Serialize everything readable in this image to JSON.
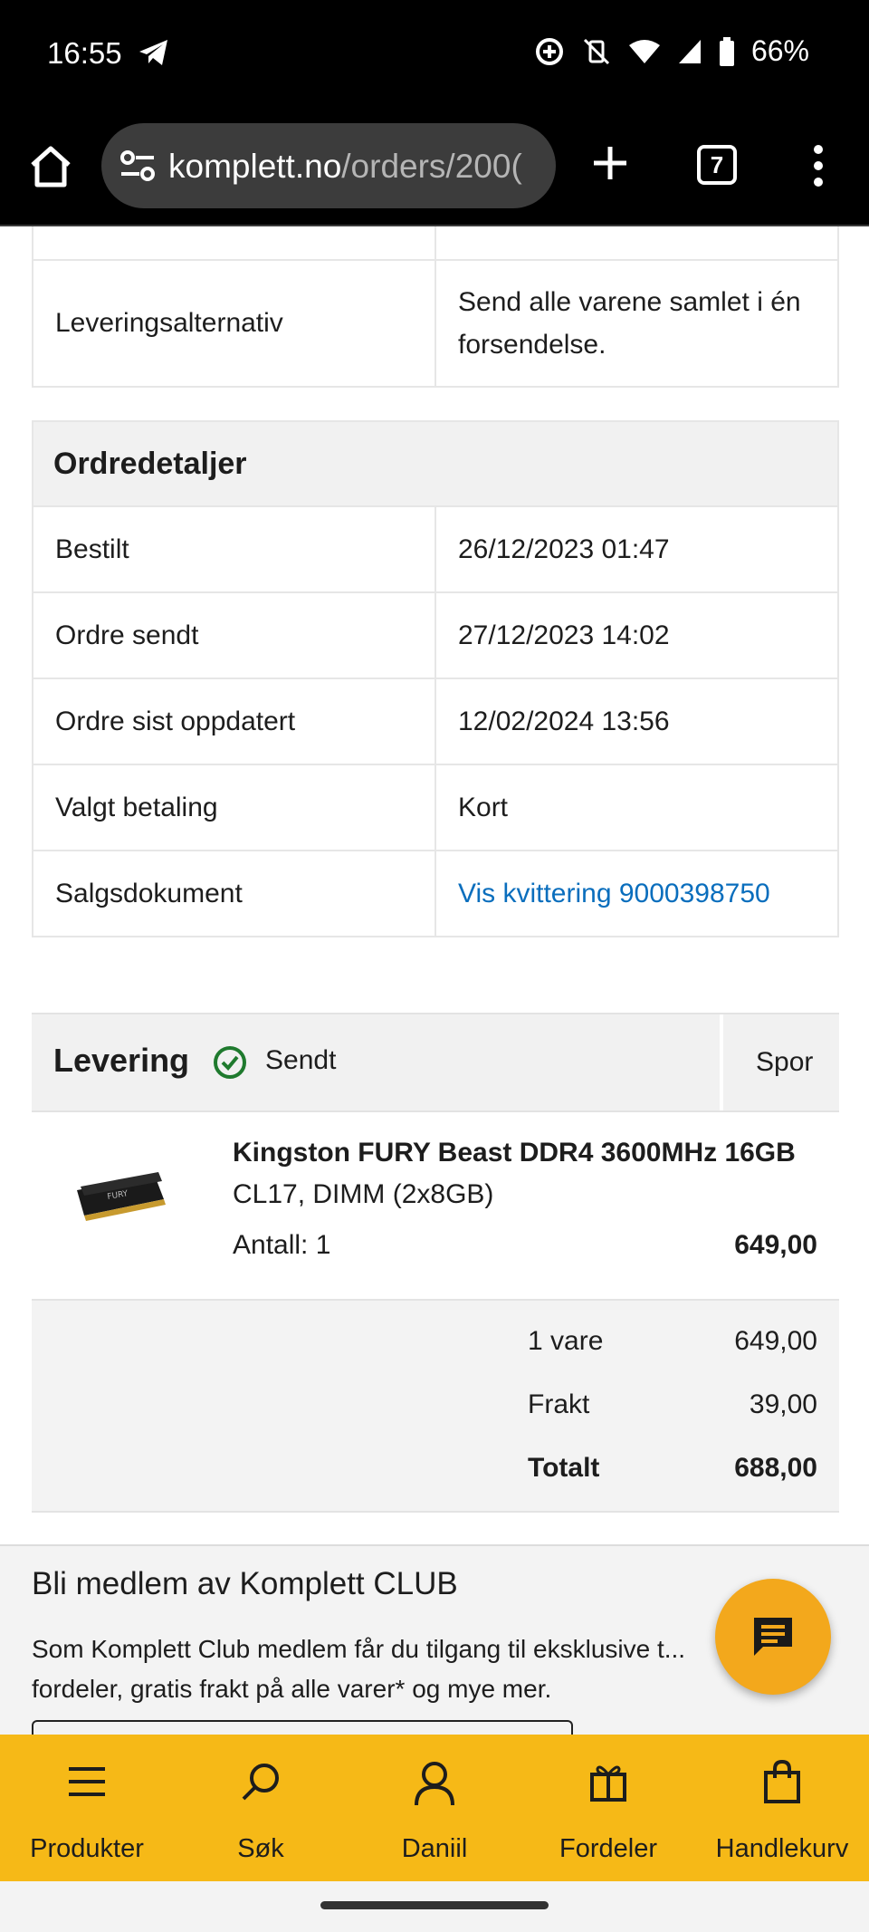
{
  "status_bar": {
    "time": "16:55",
    "battery": "66%"
  },
  "browser": {
    "url_host": "komplett.no",
    "url_path": "/orders/200(",
    "tab_count": "7"
  },
  "delivery_info": {
    "rows": [
      {
        "label": "Leveringsalternativ",
        "value": "Send alle varene samlet i én forsendelse."
      }
    ]
  },
  "order_details": {
    "title": "Ordredetaljer",
    "rows": [
      {
        "label": "Bestilt",
        "value": "26/12/2023 01:47"
      },
      {
        "label": "Ordre sendt",
        "value": "27/12/2023 14:02"
      },
      {
        "label": "Ordre sist oppdatert",
        "value": "12/02/2024 13:56"
      },
      {
        "label": "Valgt betaling",
        "value": "Kort"
      },
      {
        "label": "Salgsdokument",
        "value": "Vis kvittering 9000398750"
      }
    ]
  },
  "delivery": {
    "title": "Levering",
    "status": "Sendt",
    "track_label": "Spor",
    "status_color": "#1f7a2e"
  },
  "item": {
    "name_bold": "Kingston FURY Beast DDR4 3600MHz 16GB",
    "name_rest": "CL17, DIMM (2x8GB)",
    "quantity": "Antall: 1",
    "price": "649,00"
  },
  "totals": {
    "lines": [
      {
        "label": "1 vare",
        "value": "649,00"
      },
      {
        "label": "Frakt",
        "value": "39,00"
      },
      {
        "label": "Totalt",
        "value": "688,00"
      }
    ]
  },
  "club": {
    "title": "Bli medlem av Komplett CLUB",
    "text": "Som Komplett Club medlem får du tilgang til eksklusive t... fordeler, gratis frakt på alle varer* og mye mer."
  },
  "bottom_nav": {
    "items": [
      {
        "label": "Produkter",
        "icon": "menu-icon"
      },
      {
        "label": "Søk",
        "icon": "search-icon"
      },
      {
        "label": "Daniil",
        "icon": "user-icon"
      },
      {
        "label": "Fordeler",
        "icon": "gift-icon"
      },
      {
        "label": "Handlekurv",
        "icon": "bag-icon"
      }
    ]
  },
  "colors": {
    "brand_yellow": "#f6b917",
    "link_blue": "#0a6ebd",
    "fab_orange": "#f3a81c"
  }
}
